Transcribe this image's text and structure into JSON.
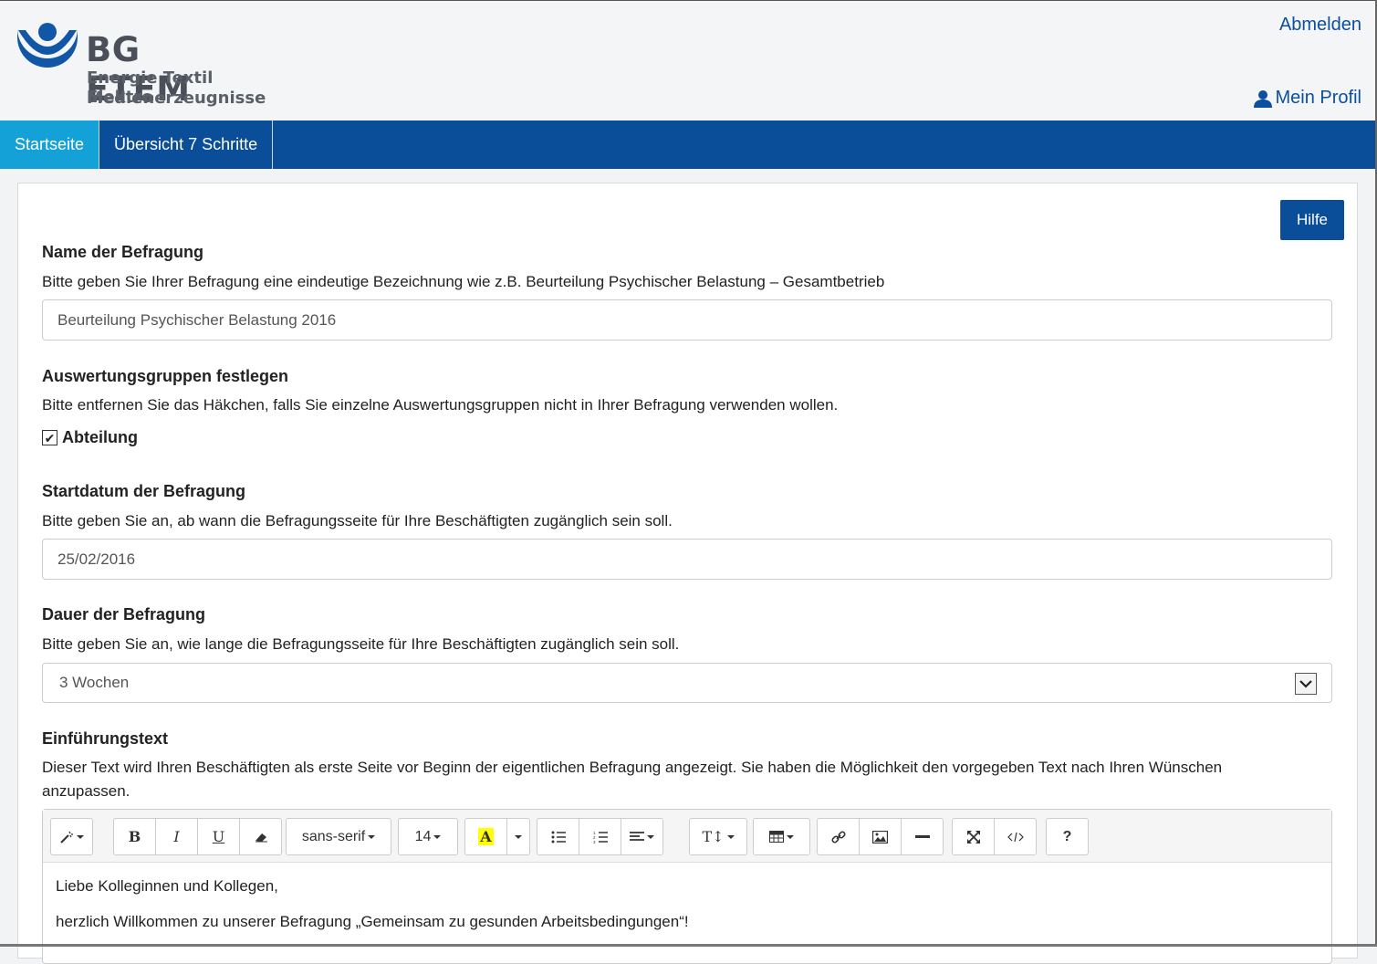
{
  "header": {
    "logo_title": "BG ETEM",
    "logo_line1": "Energie Textil Elektro",
    "logo_line2": "Medienerzeugnisse",
    "logout": "Abmelden",
    "profile": "Mein Profil"
  },
  "nav": {
    "items": [
      {
        "label": "Startseite",
        "active": true
      },
      {
        "label": "Übersicht 7 Schritte",
        "active": false
      }
    ]
  },
  "help_button": "Hilfe",
  "name_section": {
    "title": "Name der Befragung",
    "desc": "Bitte geben Sie Ihrer Befragung eine eindeutige Bezeichnung wie z.B. Beurteilung Psychischer Belastung – Gesamtbetrieb",
    "value": "Beurteilung Psychischer Belastung 2016"
  },
  "groups_section": {
    "title": "Auswertungsgruppen festlegen",
    "desc": "Bitte entfernen Sie das Häkchen, falls Sie einzelne Auswertungsgruppen nicht in Ihrer Befragung verwenden wollen.",
    "checkbox_label": "Abteilung",
    "checked": true
  },
  "start_section": {
    "title": "Startdatum der Befragung",
    "desc": "Bitte geben Sie an, ab wann die Befragungsseite für Ihre Beschäftigten zugänglich sein soll.",
    "value": "25/02/2016"
  },
  "duration_section": {
    "title": "Dauer der Befragung",
    "desc": "Bitte geben Sie an, wie lange die Befragungsseite für Ihre Beschäftigten zugänglich sein soll.",
    "selected": "3 Wochen"
  },
  "intro_section": {
    "title": "Einführungstext",
    "desc_line1": "Dieser Text wird Ihren Beschäftigten als erste Seite vor Beginn der eigentlichen Befragung angezeigt. Sie haben die Möglichkeit den vorgegeben Text nach Ihren Wünschen",
    "desc_line2": "anzupassen."
  },
  "editor": {
    "font_family": "sans-serif",
    "font_size": "14",
    "paragraphs": [
      "Liebe Kolleginnen und Kollegen,",
      "herzlich Willkommen zu unserer Befragung „Gemeinsam zu gesunden Arbeitsbedingungen“!"
    ]
  },
  "colors": {
    "brand_blue": "#0a4e9a",
    "active_tab": "#14a1d8",
    "link_blue": "#0b4ea2"
  }
}
